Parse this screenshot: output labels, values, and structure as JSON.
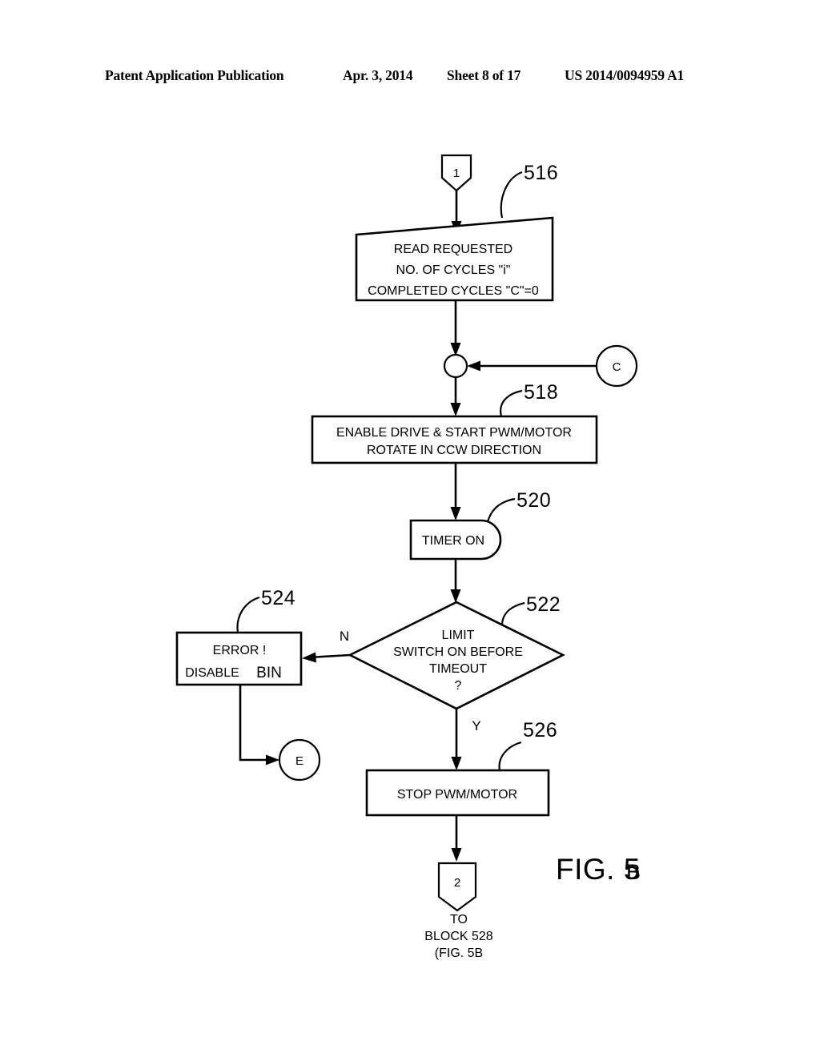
{
  "header": {
    "publication": "Patent Application Publication",
    "date": "Apr. 3, 2014",
    "sheet": "Sheet 8 of 17",
    "patent_number": "US 2014/0094959 A1"
  },
  "figure": {
    "caption_main": "FIG. 5",
    "caption_sub": "B"
  },
  "flowchart": {
    "connector_in": {
      "label": "1"
    },
    "connector_c": {
      "label": "C"
    },
    "connector_e": {
      "label": "E"
    },
    "connector_out": {
      "label": "2"
    },
    "tail_note": {
      "line1": "TO",
      "line2": "BLOCK 528",
      "line3": "(FIG. 5B"
    },
    "branch_labels": {
      "no": "N",
      "yes": "Y"
    },
    "steps": [
      {
        "ref": "516",
        "shape": "slanted-data",
        "lines": [
          "READ REQUESTED",
          "NO. OF CYCLES \"i\"",
          "COMPLETED CYCLES \"C\"=0"
        ]
      },
      {
        "ref": "518",
        "shape": "process",
        "lines": [
          "ENABLE DRIVE & START PWM/MOTOR",
          "ROTATE IN CCW DIRECTION"
        ]
      },
      {
        "ref": "520",
        "shape": "d-shape",
        "lines": [
          "TIMER ON"
        ]
      },
      {
        "ref": "522",
        "shape": "decision",
        "lines": [
          "LIMIT",
          "SWITCH ON BEFORE",
          "TIMEOUT",
          "?"
        ]
      },
      {
        "ref": "524",
        "shape": "process",
        "lines": [
          "ERROR !",
          "DISABLE ",
          "BIN"
        ]
      },
      {
        "ref": "526",
        "shape": "process",
        "lines": [
          "STOP PWM/MOTOR"
        ]
      }
    ]
  }
}
